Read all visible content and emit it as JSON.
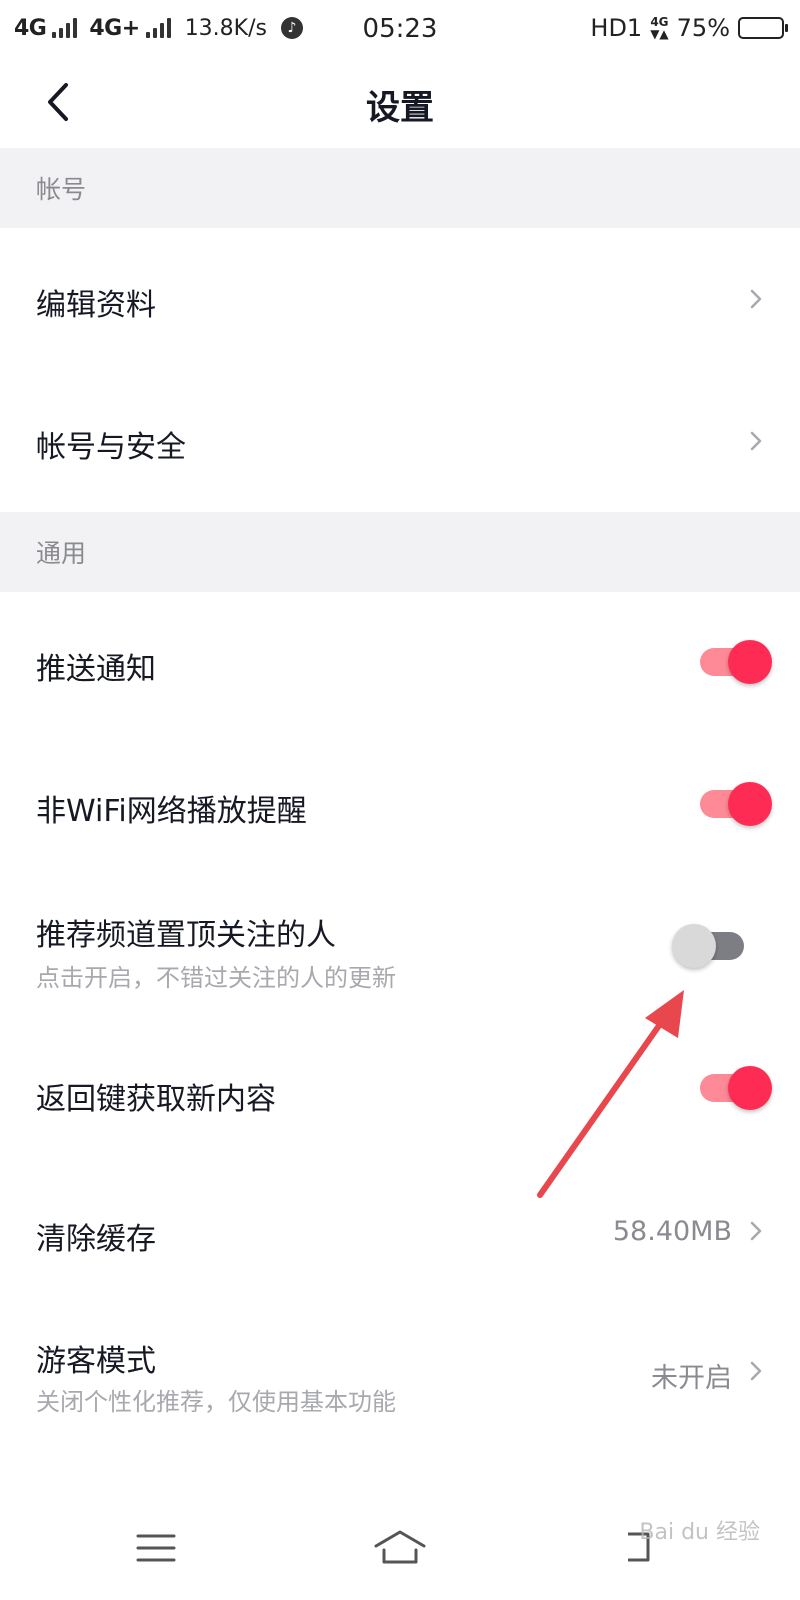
{
  "status_bar": {
    "network1": "4G",
    "network2": "4G+",
    "speed": "13.8K/s",
    "time": "05:23",
    "hd": "HD1",
    "volte": "4G",
    "battery": "75%",
    "battery_level": 0.75
  },
  "nav": {
    "title": "设置"
  },
  "sections": {
    "account": {
      "header": "帐号",
      "edit_profile": "编辑资料",
      "account_security": "帐号与安全"
    },
    "general": {
      "header": "通用",
      "push": {
        "label": "推送通知",
        "on": true
      },
      "non_wifi": {
        "label": "非WiFi网络播放提醒",
        "on": true
      },
      "pin_followed": {
        "label": "推荐频道置顶关注的人",
        "sub": "点击开启，不错过关注的人的更新",
        "on": false
      },
      "back_refresh": {
        "label": "返回键获取新内容",
        "on": true
      },
      "clear_cache": {
        "label": "清除缓存",
        "value": "58.40MB"
      },
      "guest_mode": {
        "label": "游客模式",
        "sub": "关闭个性化推荐，仅使用基本功能",
        "value": "未开启"
      }
    }
  },
  "watermark": "Bai du 经验",
  "colors": {
    "accent": "#fe2c55",
    "accent_track": "#fe8a97",
    "section_bg": "#f2f2f4",
    "annotation": "#e8474e"
  }
}
